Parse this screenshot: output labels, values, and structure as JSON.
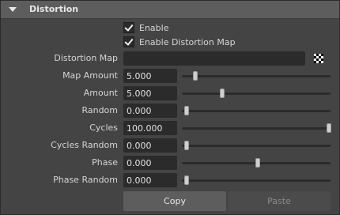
{
  "section": {
    "title": "Distortion"
  },
  "checks": {
    "enable": {
      "label": "Enable",
      "checked": true
    },
    "enable_map": {
      "label": "Enable Distortion Map",
      "checked": true
    }
  },
  "distortion_map": {
    "label": "Distortion Map",
    "icon": "checker-icon"
  },
  "params": [
    {
      "label": "Map Amount",
      "value": "5.000",
      "slider_fraction": 0.06
    },
    {
      "label": "Amount",
      "value": "5.000",
      "slider_fraction": 0.25
    },
    {
      "label": "Random",
      "value": "0.000",
      "slider_fraction": 0.0
    },
    {
      "label": "Cycles",
      "value": "100.000",
      "slider_fraction": 1.0
    },
    {
      "label": "Cycles Random",
      "value": "0.000",
      "slider_fraction": 0.0
    },
    {
      "label": "Phase",
      "value": "0.000",
      "slider_fraction": 0.5
    },
    {
      "label": "Phase Random",
      "value": "0.000",
      "slider_fraction": 0.0
    }
  ],
  "buttons": {
    "copy": "Copy",
    "paste": "Paste"
  }
}
